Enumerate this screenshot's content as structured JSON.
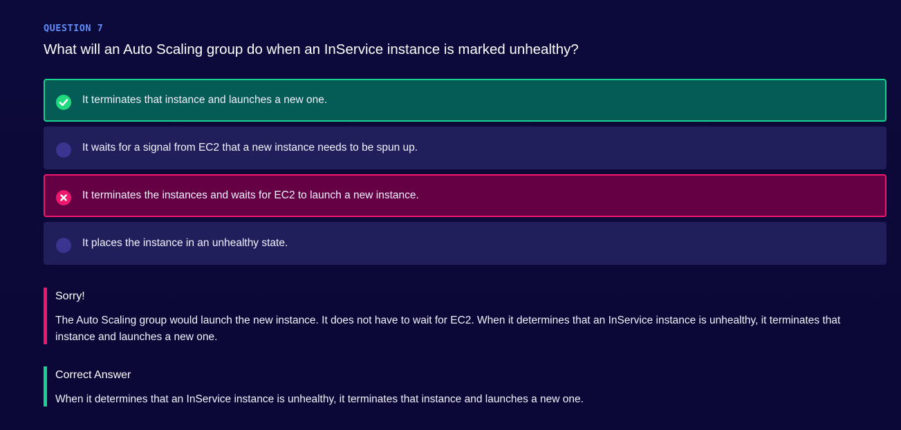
{
  "question": {
    "label": "QUESTION 7",
    "text": "What will an Auto Scaling group do when an InService instance is marked unhealthy?"
  },
  "options": [
    {
      "text": "It terminates that instance and launches a new one.",
      "state": "correct",
      "icon": "check-circle-icon"
    },
    {
      "text": "It waits for a signal from EC2 that a new instance needs to be spun up.",
      "state": "neutral",
      "icon": "radio-empty-icon"
    },
    {
      "text": "It terminates the instances and waits for EC2 to launch a new instance.",
      "state": "wrong",
      "icon": "x-circle-icon"
    },
    {
      "text": "It places the instance in an unhealthy state.",
      "state": "neutral",
      "icon": "radio-empty-icon"
    }
  ],
  "feedback": {
    "title": "Sorry!",
    "body": "The Auto Scaling group would launch the new instance. It does not have to wait for EC2. When it determines that an InService instance is unhealthy, it terminates that instance and launches a new one."
  },
  "correct_answer": {
    "title": "Correct Answer",
    "body": "When it determines that an InService instance is unhealthy, it terminates that instance and launches a new one."
  },
  "colors": {
    "background": "#0c0a3a",
    "label_accent": "#5f8cf7",
    "option_neutral": "#211e5c",
    "option_correct": "#055b55",
    "option_correct_border": "#1ad18e",
    "option_wrong": "#640043",
    "option_wrong_border": "#f0186d"
  }
}
